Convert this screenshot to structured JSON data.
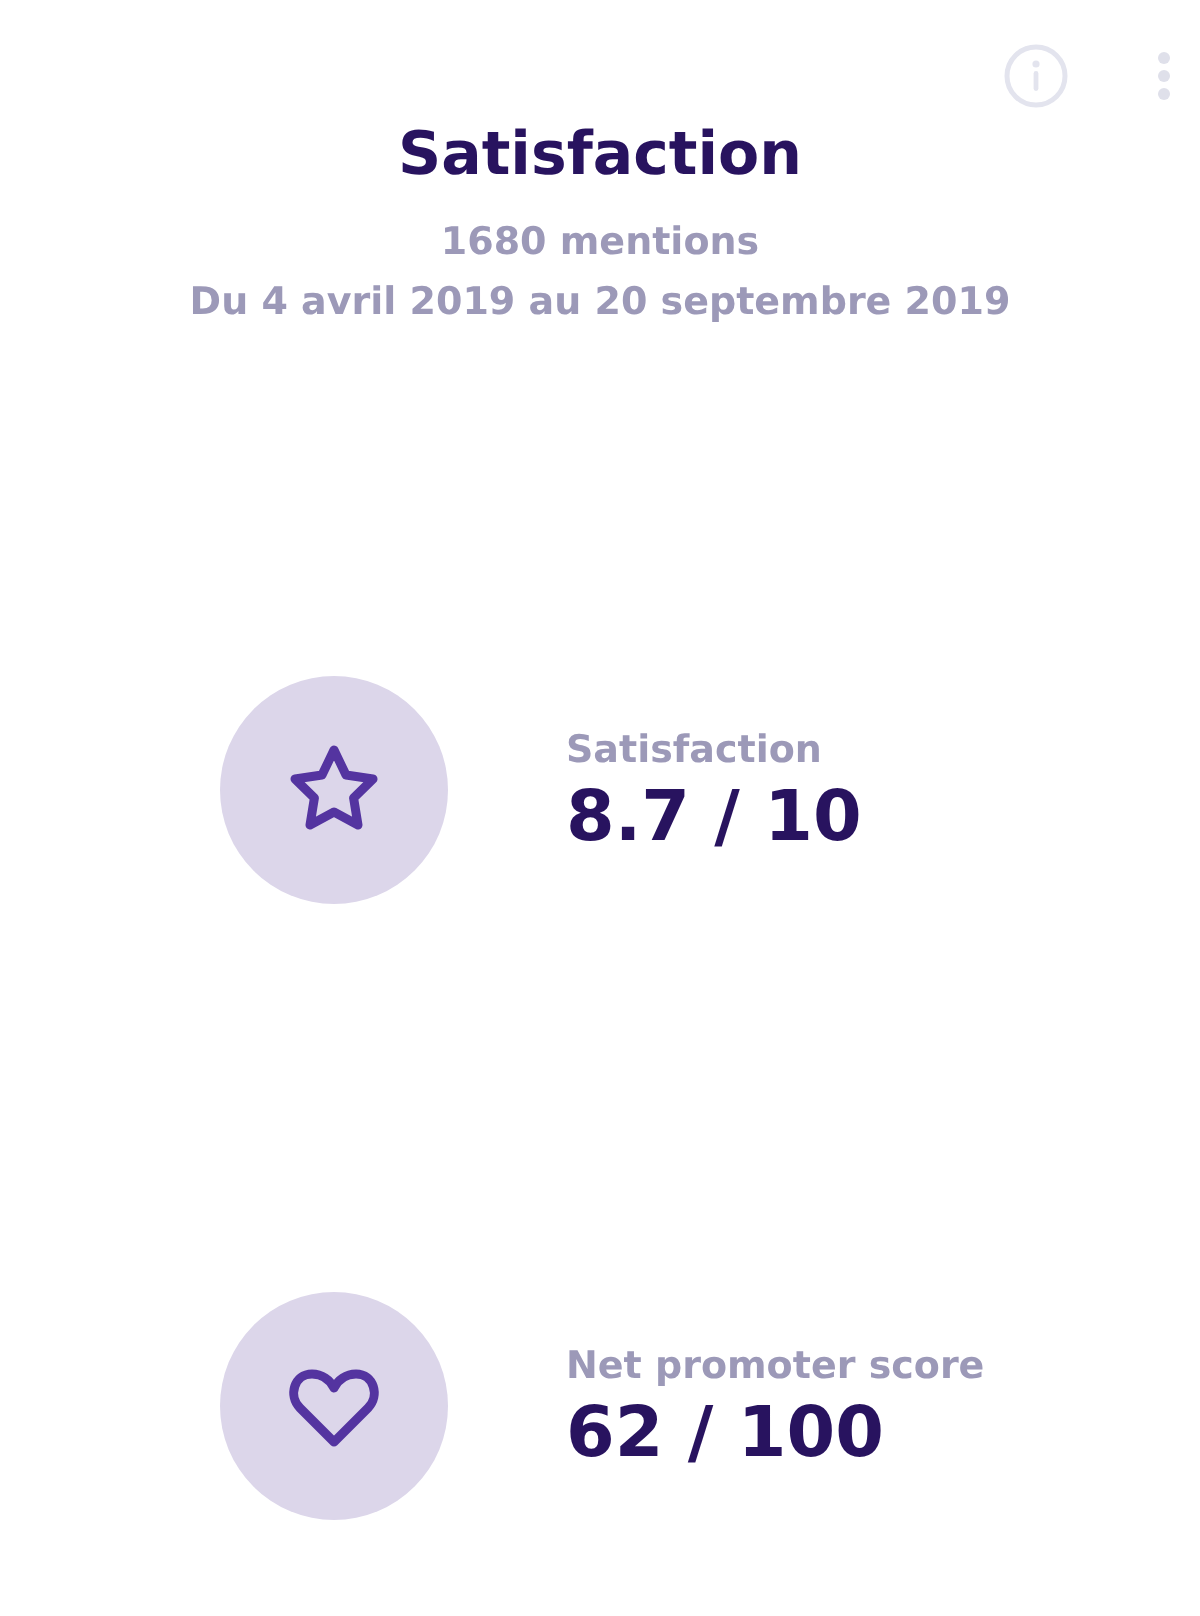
{
  "header": {
    "title": "Satisfaction",
    "mentions": "1680 mentions",
    "period": "Du 4 avril 2019 au 20 septembre 2019"
  },
  "metrics": [
    {
      "kind": "star",
      "label": "Satisfaction",
      "value": "8.7 / 10"
    },
    {
      "kind": "heart",
      "label": "Net promoter score",
      "value": "62 / 100"
    }
  ]
}
